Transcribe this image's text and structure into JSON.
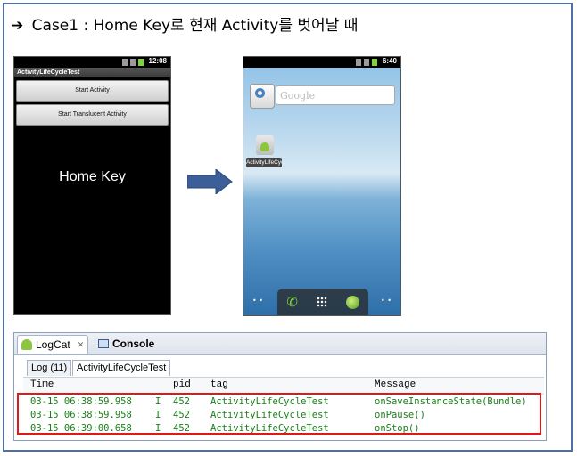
{
  "heading": {
    "arrow": "➔",
    "text": "Case1 : Home Key로 현재 Activity를 벗어날 때"
  },
  "phone1": {
    "time": "12:08",
    "app_title": "ActivityLifeCycleTest",
    "buttons": [
      "Start Activity",
      "Start Translucent Activity"
    ],
    "overlay_label": "Home Key"
  },
  "phone2": {
    "time": "6:40",
    "search_placeholder": "Google",
    "app_label": "ActivityLifeCycleTest"
  },
  "logcat": {
    "tabs": {
      "logcat": "LogCat",
      "console": "Console"
    },
    "subtabs": [
      "Log (11)",
      "ActivityLifeCycleTest"
    ],
    "columns": {
      "time": "Time",
      "pid": "pid",
      "tag": "tag",
      "message": "Message"
    },
    "rows": [
      {
        "time": "03-15 06:38:59.958",
        "level": "I",
        "pid": "452",
        "tag": "ActivityLifeCycleTest",
        "message": "onSaveInstanceState(Bundle)"
      },
      {
        "time": "03-15 06:38:59.958",
        "level": "I",
        "pid": "452",
        "tag": "ActivityLifeCycleTest",
        "message": "onPause()"
      },
      {
        "time": "03-15 06:39:00.658",
        "level": "I",
        "pid": "452",
        "tag": "ActivityLifeCycleTest",
        "message": "onStop()"
      }
    ]
  },
  "colors": {
    "frame": "#4f6fa8",
    "highlight": "#e01818",
    "log_text": "#1a7f1a",
    "arrow": "#3c5f9a"
  }
}
